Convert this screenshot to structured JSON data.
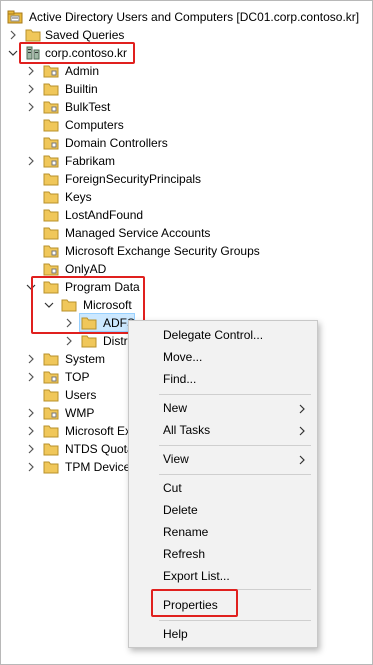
{
  "window": {
    "title": "Active Directory Users and Computers [DC01.corp.contoso.kr]"
  },
  "tree": {
    "root": {
      "label": "Active Directory Users and Computers [DC01.corp.contoso.kr]",
      "icon": "directory-root-icon"
    },
    "saved_queries": {
      "label": "Saved Queries",
      "icon": "folder-icon"
    },
    "domain": {
      "label": "corp.contoso.kr",
      "icon": "domain-icon"
    },
    "items": [
      {
        "label": "Admin",
        "icon": "ou-folder-icon"
      },
      {
        "label": "Builtin",
        "icon": "folder-icon"
      },
      {
        "label": "BulkTest",
        "icon": "ou-folder-icon"
      },
      {
        "label": "Computers",
        "icon": "folder-icon"
      },
      {
        "label": "Domain Controllers",
        "icon": "ou-folder-icon"
      },
      {
        "label": "Fabrikam",
        "icon": "ou-folder-icon"
      },
      {
        "label": "ForeignSecurityPrincipals",
        "icon": "folder-icon"
      },
      {
        "label": "Keys",
        "icon": "folder-icon"
      },
      {
        "label": "LostAndFound",
        "icon": "folder-icon"
      },
      {
        "label": "Managed Service Accounts",
        "icon": "folder-icon"
      },
      {
        "label": "Microsoft Exchange Security Groups",
        "icon": "ou-folder-icon"
      },
      {
        "label": "OnlyAD",
        "icon": "ou-folder-icon"
      },
      {
        "label": "Program Data",
        "icon": "folder-icon"
      },
      {
        "label": "Microsoft",
        "icon": "folder-icon"
      },
      {
        "label": "ADFS",
        "icon": "folder-icon"
      },
      {
        "label": "Distr",
        "icon": "folder-icon"
      },
      {
        "label": "System",
        "icon": "folder-icon"
      },
      {
        "label": "TOP",
        "icon": "ou-folder-icon"
      },
      {
        "label": "Users",
        "icon": "folder-icon"
      },
      {
        "label": "WMP",
        "icon": "ou-folder-icon"
      },
      {
        "label": "Microsoft Ex",
        "icon": "folder-icon"
      },
      {
        "label": "NTDS Quota",
        "icon": "folder-icon"
      },
      {
        "label": "TPM Device",
        "icon": "folder-icon"
      }
    ]
  },
  "context_menu": {
    "delegate_control": "Delegate Control...",
    "move": "Move...",
    "find": "Find...",
    "new": "New",
    "all_tasks": "All Tasks",
    "view": "View",
    "cut": "Cut",
    "delete": "Delete",
    "rename": "Rename",
    "refresh": "Refresh",
    "export_list": "Export List...",
    "properties": "Properties",
    "help": "Help"
  },
  "colors": {
    "highlight_box": "#e0201e",
    "selection": "#cce8ff",
    "folder": "#e8b93a",
    "menu_bg": "#f2f2f2"
  }
}
